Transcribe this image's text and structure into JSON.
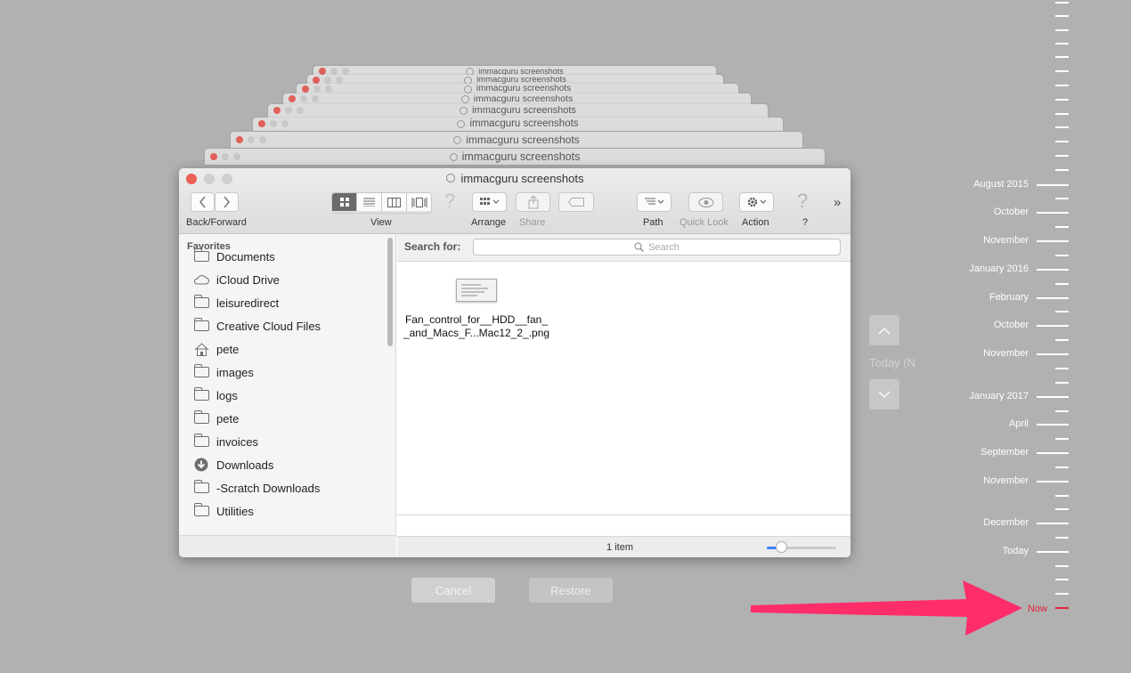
{
  "window": {
    "title": "immacguru screenshots",
    "ghost_titles": [
      "immacguru screenshots",
      "immacguru screenshots",
      "immacguru screenshots",
      "immacguru screenshots",
      "immacguru screenshots",
      "immacguru screenshots",
      "immacguru screenshots",
      "immacguru screenshots"
    ]
  },
  "toolbar": {
    "back_forward_label": "Back/Forward",
    "view_label": "View",
    "arrange_label": "Arrange",
    "share_label": "Share",
    "path_label": "Path",
    "quick_look_label": "Quick Look",
    "action_label": "Action",
    "help_label": "?",
    "overflow": "»"
  },
  "sidebar": {
    "heading": "Favorites",
    "items": [
      {
        "label": "Documents",
        "icon": "folder-icon"
      },
      {
        "label": "iCloud Drive",
        "icon": "cloud-icon"
      },
      {
        "label": "leisuredirect",
        "icon": "folder-icon"
      },
      {
        "label": "Creative Cloud Files",
        "icon": "folder-icon"
      },
      {
        "label": "pete",
        "icon": "home-icon"
      },
      {
        "label": "images",
        "icon": "folder-icon"
      },
      {
        "label": "logs",
        "icon": "folder-icon"
      },
      {
        "label": "pete",
        "icon": "folder-icon"
      },
      {
        "label": "invoices",
        "icon": "folder-icon"
      },
      {
        "label": "Downloads",
        "icon": "download-icon"
      },
      {
        "label": "-Scratch Downloads",
        "icon": "folder-icon"
      },
      {
        "label": "Utilities",
        "icon": "folder-icon"
      }
    ]
  },
  "search": {
    "label": "Search for:",
    "placeholder": "Search"
  },
  "files": [
    {
      "name_line1": "Fan_control_for__HDD__fan_",
      "name_line2": "_and_Macs_F...Mac12_2_.png"
    }
  ],
  "status": {
    "item_count": "1 item",
    "zoom_level": 0.2
  },
  "dialog": {
    "cancel_label": "Cancel",
    "restore_label": "Restore",
    "today_label": "Today (N"
  },
  "timeline": {
    "labels": [
      "August 2015",
      "October",
      "November",
      "January 2016",
      "February",
      "October",
      "November",
      "January 2017",
      "April",
      "September",
      "November",
      "December",
      "Today"
    ],
    "now_label": "Now"
  },
  "colors": {
    "background": "#b1b1b1",
    "close": "#ec5f57",
    "now_accent": "#e5223a",
    "arrow": "#ff2d6a",
    "zoom_accent": "#3a82f7"
  }
}
